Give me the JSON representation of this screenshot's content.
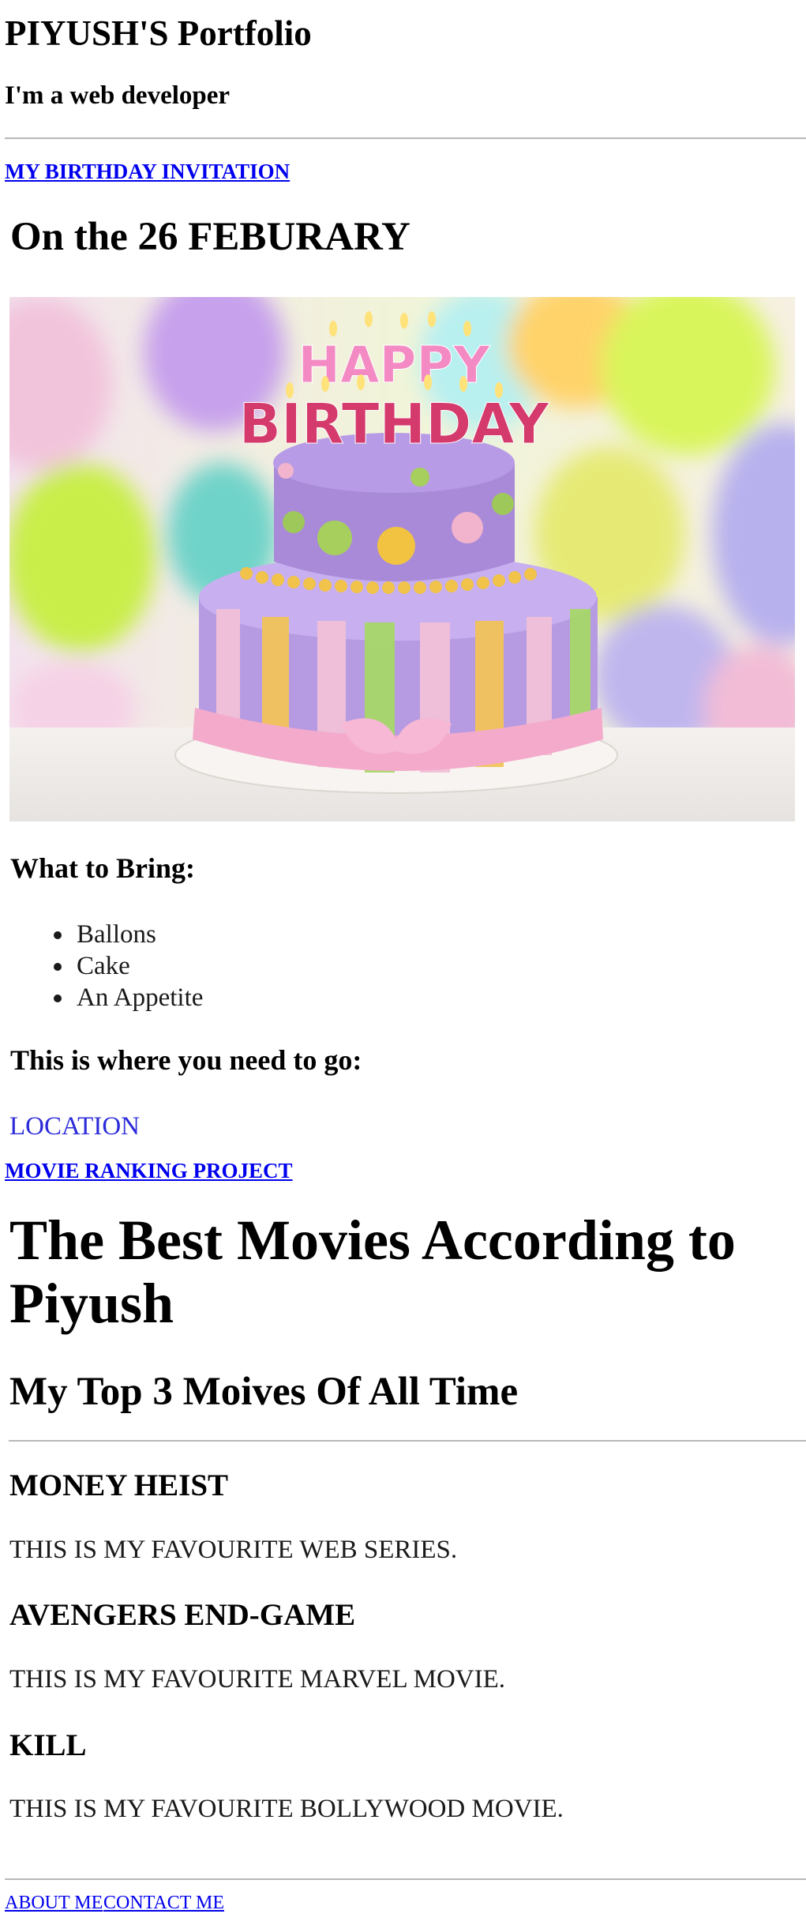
{
  "header": {
    "title": "PIYUSH'S Portfolio",
    "tagline": "I'm a web developer"
  },
  "links": {
    "birthday": "MY BIRTHDAY INVITATION",
    "movies": "MOVIE RANKING PROJECT",
    "about": "ABOUT ME",
    "contact": "CONTACT ME"
  },
  "invitation": {
    "heading": "On the 26 FEBURARY",
    "image_label": "HAPPY BIRTHDAY",
    "what_to_bring": "What to Bring:",
    "items": [
      "Ballons",
      "Cake",
      "An Appetite"
    ],
    "where_heading": "This is where you need to go:",
    "location_link": "LOCATION"
  },
  "movies": {
    "title": "The Best Movies According to Piyush",
    "subtitle": "My Top 3 Moives Of All Time",
    "list": [
      {
        "name": "MONEY HEIST",
        "desc": "THIS IS MY FAVOURITE WEB SERIES."
      },
      {
        "name": "AVENGERS END-GAME",
        "desc": "THIS IS MY FAVOURITE MARVEL MOVIE."
      },
      {
        "name": "KILL",
        "desc": "THIS IS MY FAVOURITE BOLLYWOOD MOVIE."
      }
    ]
  }
}
